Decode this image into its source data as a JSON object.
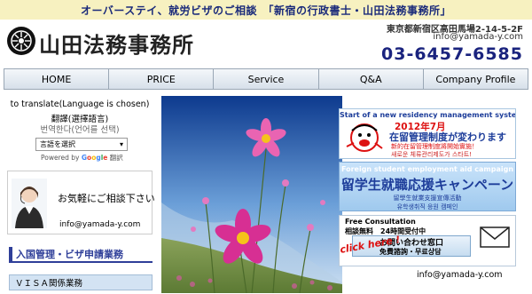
{
  "topbar": {
    "tagline": "オーバーステイ、就労ビザのご相談　「新宿の行政書士・山田法務事務所」"
  },
  "header": {
    "logo_title": "山田法務事務所",
    "address": "東京都新宿区高田馬場2-14-5-2F",
    "email": "info@yamada-y.com",
    "phone": "03-6457-6585"
  },
  "nav": {
    "items": [
      {
        "label": "HOME"
      },
      {
        "label": "PRICE"
      },
      {
        "label": "Service"
      },
      {
        "label": "Q&A"
      },
      {
        "label": "Company Profile"
      }
    ]
  },
  "sidebar": {
    "translate_en": "to translate(Language is chosen)",
    "translate_zh": "翻譯(選擇語言)",
    "translate_ko": "번역한다(언어를 선택)",
    "language_select": "言語を選択",
    "powered_prefix": "Powered by",
    "google_letters": [
      "G",
      "o",
      "o",
      "g",
      "l",
      "e"
    ],
    "powered_suffix": "翻訳",
    "consult_text": "お気軽にご相談下さい",
    "consult_email": "info@yamada-y.com",
    "section_heading": "入国管理・ビザ申請業務",
    "visa_item": "ＶＩＳＡ関係業務"
  },
  "banners": {
    "residency": {
      "head": "Start of a new residency management system!",
      "title": "2012年7月",
      "subtitle": "在留管理制度が変わります",
      "small": "新的在留管理制度將開始實施！",
      "korean": "새로운 체류관리제도가 스타트!"
    },
    "student": {
      "head": "Foreign student employment aid campaign",
      "title": "留学生就職応援キャンペーン",
      "sub": "留學生就業支援宣傳活動",
      "korean": "유학생취직 응원 캠페인"
    },
    "consult": {
      "head": "Free Consultation",
      "free": "相談無料　24時間受付中",
      "window": "お問い合わせ窓口",
      "note": "免費諮詢・무료상담",
      "click": "click here !"
    }
  },
  "footer": {
    "email": "info@yamada-y.com"
  },
  "colors": {
    "topbar_bg": "#f7f1c0",
    "brand_blue": "#1a237e",
    "nav_bg": "#d7e0ea",
    "section_accent": "#2f3f99",
    "highlight_red": "#d11"
  }
}
